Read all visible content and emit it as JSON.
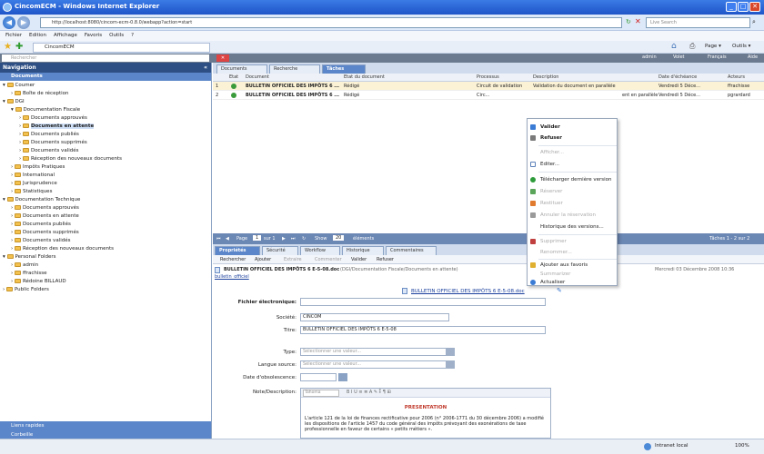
{
  "window": {
    "title": "CincomECM - Windows Internet Explorer"
  },
  "browser": {
    "url": "http://localhost:8080/cincom-ecm-0.8.0/webapp?action=start",
    "search_placeholder": "Live Search",
    "menu": [
      "Fichier",
      "Edition",
      "Affichage",
      "Favoris",
      "Outils",
      "?"
    ],
    "favorite_tab": "CincomECM",
    "page_btn": "Page",
    "tools_btn": "Outils"
  },
  "app_header": {
    "search_placeholder": "Rechercher",
    "user": "admin",
    "help": "Aide",
    "lang": "Français",
    "info": "Volet"
  },
  "sidebar": {
    "title": "Navigation",
    "documents_header": "Documents",
    "items": [
      "Coumer",
      "Boîte de réception",
      "DGI",
      "Documentation Fiscale",
      "Documents approuvés",
      "Documents en attente",
      "Documents publiés",
      "Documents supprimés",
      "Documents validés",
      "Réception des nouveaux documents",
      "Impôts Pratiques",
      "International",
      "Jurisprudence",
      "Statistiques",
      "Documentation Technique",
      "Documents approuvés",
      "Documents en attente",
      "Documents publiés",
      "Documents supprimés",
      "Documents validés",
      "Réception des nouveaux documents",
      "Personal Folders",
      "admin",
      "ffrachisse",
      "Rédoine BILLAUD",
      "Public Folders"
    ],
    "footer_links": "Liens rapides",
    "footer_trash": "Corbeille"
  },
  "main": {
    "tabs": [
      "Documents",
      "Recherche",
      "Tâches"
    ],
    "grid_headers": [
      "Etat",
      "Document",
      "Etat du document",
      "Processus",
      "Description",
      "Date d'échéance",
      "Acteurs"
    ],
    "rows": [
      {
        "num": "1",
        "doc": "BULLETIN OFFICIEL DES IMPÔTS 6 ...",
        "state": "Rédigé",
        "process": "Circuit de validation",
        "desc": "Validation du document en parallèle",
        "due": "Vendredi 5 Déce...",
        "actor": "ffrachisse"
      },
      {
        "num": "2",
        "doc": "BULLETIN OFFICIEL DES IMPÔTS 6 ...",
        "state": "Rédigé",
        "process": "Circ...",
        "desc": "ent en parallèle",
        "due": "Vendredi 5 Déce...",
        "actor": "pgrardard"
      }
    ],
    "pager": {
      "page": "Page",
      "page_num": "1",
      "of": "sur 1",
      "show": "Show",
      "show_num": "20",
      "elements": "éléments",
      "summary": "Tâches 1 - 2 sur 2"
    },
    "detail_tabs": [
      "Propriétés",
      "Sécurité",
      "Workflow",
      "Historique",
      "Commentaires"
    ],
    "toolbar": [
      "Rechercher",
      "Ajouter",
      "Extraire",
      "Commenter",
      "Valider",
      "Refuser"
    ],
    "doc_title": "BULLETIN OFFICIEL DES IMPÔTS 6 E-5-08.doc",
    "doc_path": "(DGI/Documentation Fiscale/Documents en attente)",
    "doc_date": "Mercredi 03 Décembre 2008 10:36",
    "doc_subtitle": "bulletin_officiel",
    "file_link": "BULLETIN OFFICIEL DES IMPÔTS 6 E-5-08.doc",
    "form": {
      "fichier_label": "Fichier électronique:",
      "societe_label": "Société:",
      "societe_value": "CINCOM",
      "titre_label": "Titre:",
      "titre_value": "BULLETIN OFFICIEL DES IMPÔTS 6 E-5-08",
      "type_label": "Type:",
      "type_value": "Sélectionner une valeur...",
      "langue_label": "Langue source:",
      "langue_value": "Sélectionner une valeur...",
      "obso_label": "Date d'obsolescence:",
      "note_label": "Note/Description:",
      "editor_style": "Tahoma",
      "editor_heading": "PRESENTATION",
      "editor_text": "L'article 121 de la loi de finances rectificative pour 2006 (n° 2006-1771 du 30 décembre 2006) a modifié les dispositions de l'article 1457 du code général des impôts prévoyant des exonérations de taxe professionnelle en faveur de certains « petits métiers »."
    }
  },
  "context_menu": {
    "items": [
      {
        "label": "Valider",
        "bold": true,
        "disabled": false,
        "color": "#3a7bd5"
      },
      {
        "label": "Refuser",
        "bold": true,
        "disabled": false,
        "color": "#7a7a7a"
      },
      {
        "label": "Afficher...",
        "bold": false,
        "disabled": true,
        "color": "#cccccc"
      },
      {
        "label": "Editer...",
        "bold": false,
        "disabled": false,
        "color": "#5a7fb8"
      },
      {
        "label": "Télécharger dernière version",
        "bold": false,
        "disabled": false,
        "color": "#2e9b3a"
      },
      {
        "label": "Réserver",
        "bold": false,
        "disabled": true,
        "color": "#5aa55a"
      },
      {
        "label": "Restituer",
        "bold": false,
        "disabled": true,
        "color": "#e07a2e"
      },
      {
        "label": "Annuler la réservation",
        "bold": false,
        "disabled": true,
        "color": "#9a9a9a"
      },
      {
        "label": "Historique des versions...",
        "bold": false,
        "disabled": false,
        "color": "#ffffff"
      },
      {
        "label": "Supprimer",
        "bold": false,
        "disabled": true,
        "color": "#c04040"
      },
      {
        "label": "Renommer...",
        "bold": false,
        "disabled": true,
        "color": "#ffffff"
      },
      {
        "label": "Ajouter aux favoris",
        "bold": false,
        "disabled": false,
        "color": "#e0b030"
      },
      {
        "label": "Summarizer",
        "bold": false,
        "disabled": true,
        "color": "#ffffff"
      },
      {
        "label": "Actualiser",
        "bold": false,
        "disabled": false,
        "color": "#3a7bd5"
      }
    ]
  },
  "statusbar": {
    "zone": "Intranet local",
    "zoom": "100%"
  }
}
